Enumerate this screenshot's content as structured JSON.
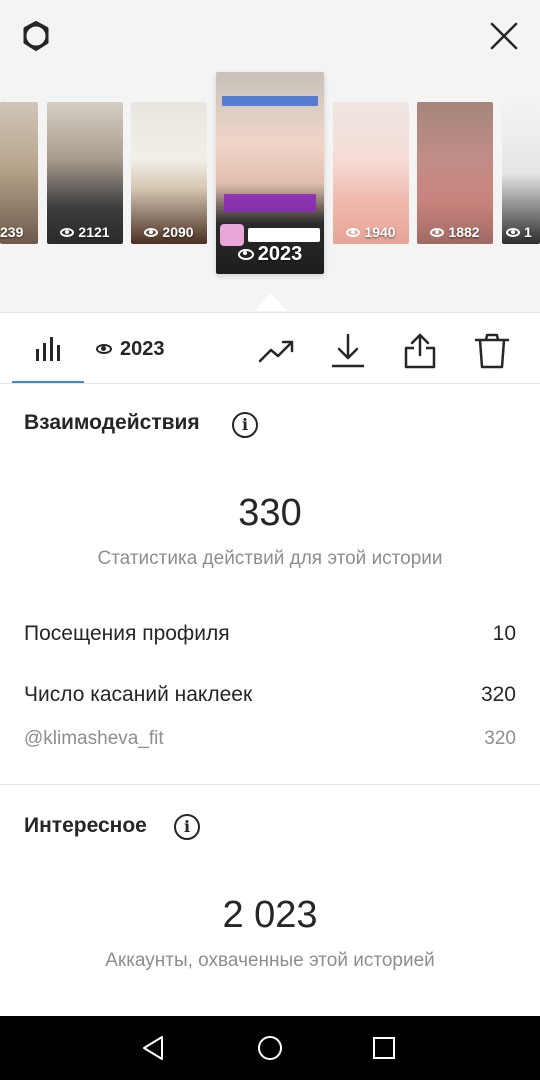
{
  "stories": [
    {
      "views": "239"
    },
    {
      "views": "2121"
    },
    {
      "views": "2090"
    },
    {
      "views": "2023",
      "selected": true
    },
    {
      "views": "1940"
    },
    {
      "views": "1882"
    },
    {
      "views": "1"
    }
  ],
  "toolbar": {
    "views": "2023",
    "icons": [
      "bar-chart-icon",
      "eye-icon",
      "trending-icon",
      "download-icon",
      "share-icon",
      "trash-icon"
    ]
  },
  "interactions": {
    "title": "Взаимодействия",
    "total": "330",
    "caption": "Статистика действий для этой истории",
    "rows": [
      {
        "label": "Посещения профиля",
        "value": "10"
      },
      {
        "label": "Число касаний наклеек",
        "value": "320"
      },
      {
        "label": "@klimasheva_fit",
        "value": "320"
      }
    ]
  },
  "discovery": {
    "title": "Интересное",
    "total": "2 023",
    "caption": "Аккаунты, охваченные этой историей"
  },
  "colors": {
    "accent": "#3a88d8",
    "text": "#262626",
    "secondary": "#8e8e8e",
    "strip_bg": "#f4f4f4"
  }
}
